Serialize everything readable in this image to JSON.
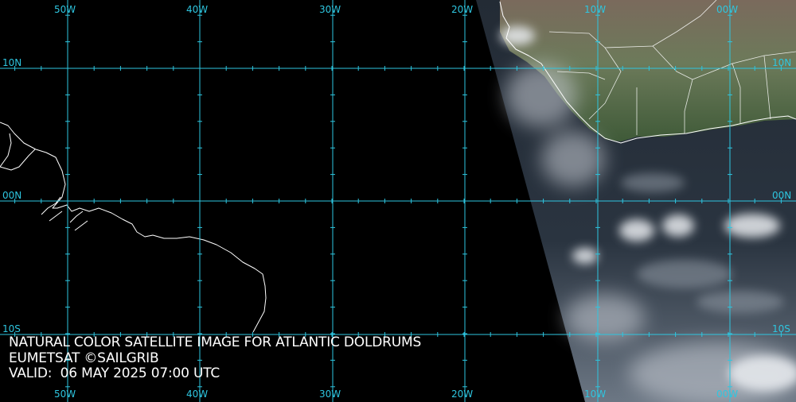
{
  "caption": {
    "line1": "NATURAL COLOR SATELLITE IMAGE FOR ATLANTIC DOLDRUMS",
    "line2": "EUMETSAT ©SAILGRIB",
    "line3": "VALID:  06 MAY 2025 07:00 UTC"
  },
  "grid": {
    "longitudes": [
      "50W",
      "40W",
      "30W",
      "20W",
      "10W",
      "00W"
    ],
    "latitudes": [
      "10N",
      "00N",
      "10S"
    ]
  },
  "colors": {
    "grid": "#2ec6e0",
    "coastline": "#ffffff",
    "background": "#000000"
  }
}
